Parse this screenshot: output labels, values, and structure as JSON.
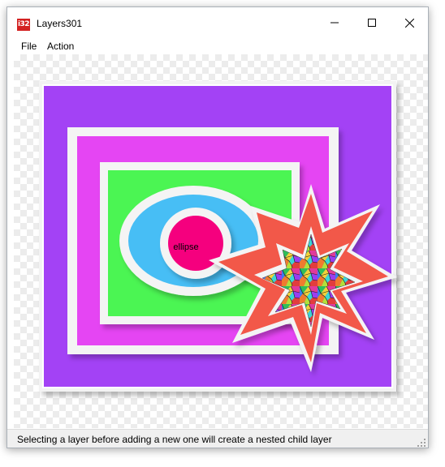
{
  "window": {
    "title": "Layers301",
    "app_icon_text": "i32"
  },
  "menu": {
    "items": [
      {
        "label": "File"
      },
      {
        "label": "Action"
      }
    ]
  },
  "canvas": {
    "layers": [
      {
        "shape": "rectangle",
        "color": "#a343f5"
      },
      {
        "shape": "rectangle",
        "color": "#e545f3"
      },
      {
        "shape": "rectangle",
        "color": "#4bf552"
      },
      {
        "shape": "ellipse",
        "color": "#47bef5"
      },
      {
        "shape": "ellipse",
        "color": "#f5007e",
        "label": "ellipse"
      },
      {
        "shape": "star",
        "color": "#f2584a"
      },
      {
        "shape": "star",
        "fill": "mosaic-pattern"
      }
    ]
  },
  "status": {
    "text": "Selecting a layer before adding a new one will create a nested child layer"
  },
  "icons": {
    "minimize": "minimize-icon",
    "maximize": "maximize-icon",
    "close": "close-icon",
    "grip": "resize-grip-icon"
  }
}
